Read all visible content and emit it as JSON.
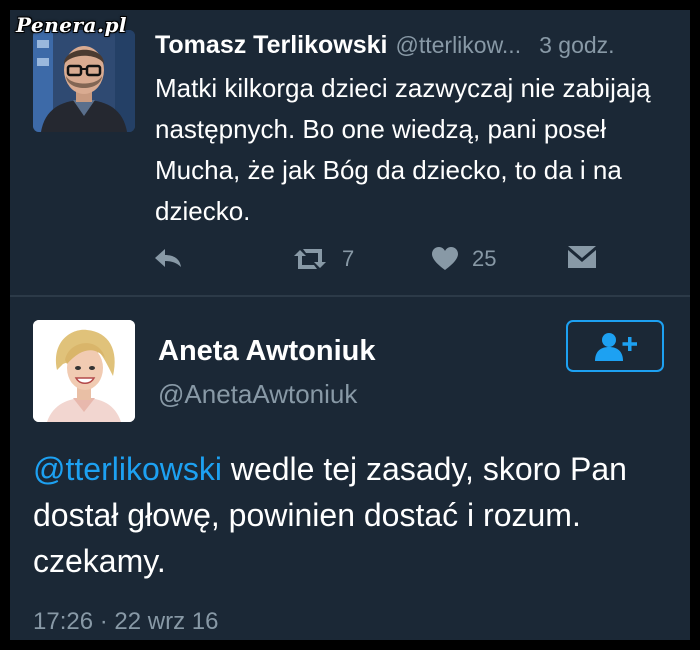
{
  "watermark": "Penera.pl",
  "tweet1": {
    "author_name": "Tomasz Terlikowski",
    "handle": "@tterlikow...",
    "time": "3 godz.",
    "text": "Matki kilkorga dzieci zazwyczaj nie zabijają następnych. Bo one wiedzą, pani poseł Mucha, że jak Bóg da dziecko, to da i na dziecko.",
    "actions": {
      "reply_icon": "reply-icon",
      "retweet_icon": "retweet-icon",
      "retweet_count": "7",
      "like_icon": "heart-icon",
      "like_count": "25",
      "dm_icon": "envelope-icon"
    }
  },
  "tweet2": {
    "author_name": "Aneta Awtoniuk",
    "handle": "@AnetaAwtoniuk",
    "follow_icon": "add-user-icon",
    "mention": "@tterlikowski",
    "text": " wedle tej zasady, skoro Pan dostał głowę, powinien dostać i rozum. czekamy.",
    "timestamp": "17:26 · 22 wrz 16"
  },
  "colors": {
    "background": "#1b2836",
    "accent": "#1da1f2",
    "muted": "#8899a6",
    "text": "#ffffff"
  }
}
